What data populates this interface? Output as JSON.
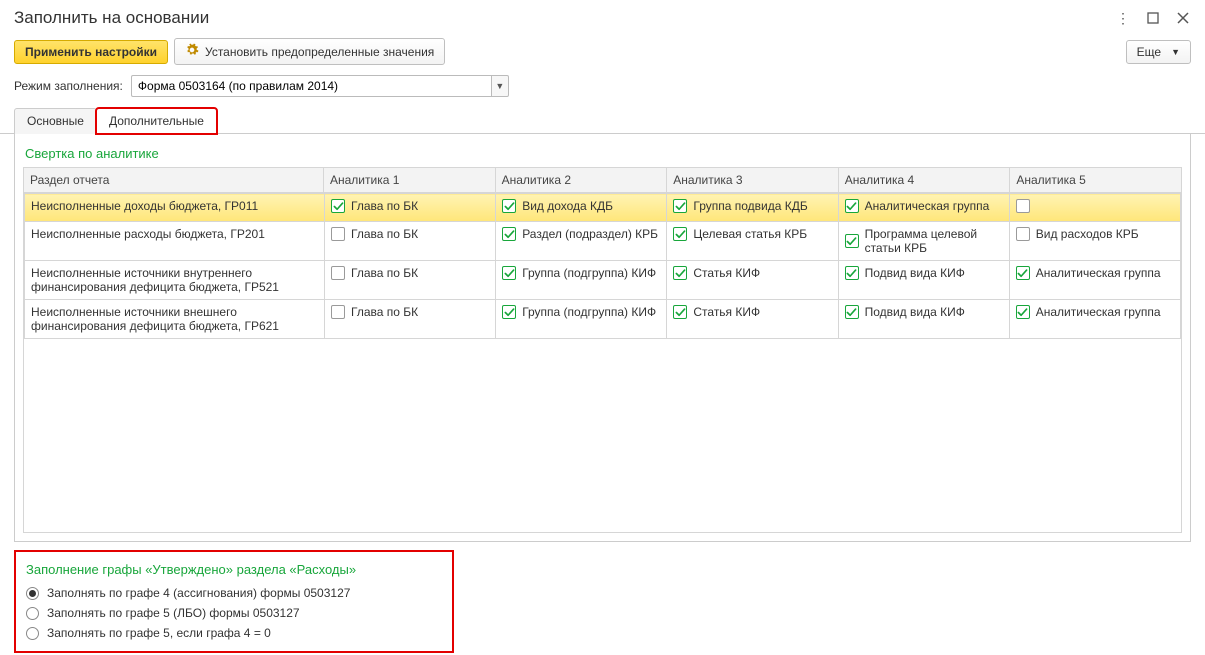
{
  "window": {
    "title": "Заполнить на основании"
  },
  "toolbar": {
    "apply": "Применить настройки",
    "preset": "Установить предопределенные значения",
    "more": "Еще"
  },
  "mode": {
    "label": "Режим заполнения:",
    "value": "Форма 0503164 (по правилам 2014)"
  },
  "tabs": {
    "main": "Основные",
    "extra": "Дополнительные"
  },
  "section1": {
    "title": "Свертка по аналитике",
    "headers": [
      "Раздел отчета",
      "Аналитика 1",
      "Аналитика 2",
      "Аналитика 3",
      "Аналитика 4",
      "Аналитика 5"
    ],
    "rows": [
      {
        "selected": true,
        "section": "Неисполненные доходы бюджета, ГР011",
        "a1": {
          "checked": true,
          "label": "Глава по БК"
        },
        "a2": {
          "checked": true,
          "label": "Вид дохода КДБ"
        },
        "a3": {
          "checked": true,
          "label": "Группа подвида КДБ"
        },
        "a4": {
          "checked": true,
          "label": "Аналитическая группа"
        },
        "a5": {
          "checked": false,
          "label": ""
        }
      },
      {
        "selected": false,
        "section": "Неисполненные расходы бюджета, ГР201",
        "a1": {
          "checked": false,
          "label": "Глава по БК"
        },
        "a2": {
          "checked": true,
          "label": "Раздел (подраздел) КРБ"
        },
        "a3": {
          "checked": true,
          "label": "Целевая статья КРБ"
        },
        "a4": {
          "checked": true,
          "label": "Программа целевой статьи КРБ"
        },
        "a5": {
          "checked": false,
          "label": "Вид расходов КРБ"
        }
      },
      {
        "selected": false,
        "section": "Неисполненные источники внутреннего финансирования дефицита бюджета, ГР521",
        "a1": {
          "checked": false,
          "label": "Глава по БК"
        },
        "a2": {
          "checked": true,
          "label": "Группа (подгруппа) КИФ"
        },
        "a3": {
          "checked": true,
          "label": "Статья КИФ"
        },
        "a4": {
          "checked": true,
          "label": "Подвид вида КИФ"
        },
        "a5": {
          "checked": true,
          "label": "Аналитическая группа"
        }
      },
      {
        "selected": false,
        "section": "Неисполненные источники внешнего финансирования дефицита бюджета, ГР621",
        "a1": {
          "checked": false,
          "label": "Глава по БК"
        },
        "a2": {
          "checked": true,
          "label": "Группа (подгруппа) КИФ"
        },
        "a3": {
          "checked": true,
          "label": "Статья КИФ"
        },
        "a4": {
          "checked": true,
          "label": "Подвид вида КИФ"
        },
        "a5": {
          "checked": true,
          "label": "Аналитическая группа"
        }
      }
    ]
  },
  "section2": {
    "title": "Заполнение графы «Утверждено» раздела «Расходы»",
    "options": [
      {
        "label": "Заполнять по графе 4 (ассигнования) формы 0503127",
        "selected": true
      },
      {
        "label": "Заполнять по графе 5 (ЛБО) формы 0503127",
        "selected": false
      },
      {
        "label": "Заполнять по графе 5, если графа 4 = 0",
        "selected": false
      }
    ]
  }
}
